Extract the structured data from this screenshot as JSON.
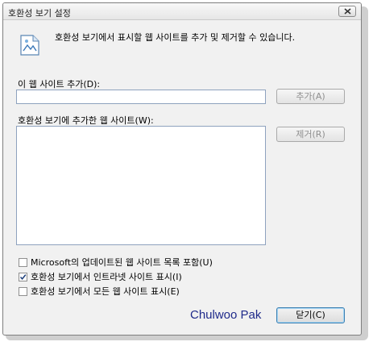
{
  "window": {
    "title": "호환성 보기 설정"
  },
  "description": "호환성 보기에서 표시할 웹 사이트를 추가 및 제거할 수 있습니다.",
  "add_site": {
    "label": "이 웹 사이트 추가(D):",
    "value": "",
    "add_button": "추가(A)"
  },
  "site_list": {
    "label": "호환성 보기에 추가한 웹 사이트(W):",
    "items": [],
    "remove_button": "제거(R)"
  },
  "options": [
    {
      "label": "Microsoft의 업데이트된 웹 사이트 목록 포함(U)",
      "checked": false
    },
    {
      "label": "호환성 보기에서 인트라넷 사이트 표시(I)",
      "checked": true
    },
    {
      "label": "호환성 보기에서 모든 웹 사이트 표시(E)",
      "checked": false
    }
  ],
  "signature": "Chulwoo Pak",
  "close_button": "닫기(C)",
  "icons": {
    "info": "document-icon",
    "titlebar_close": "close-icon",
    "check": "checkmark-icon"
  }
}
